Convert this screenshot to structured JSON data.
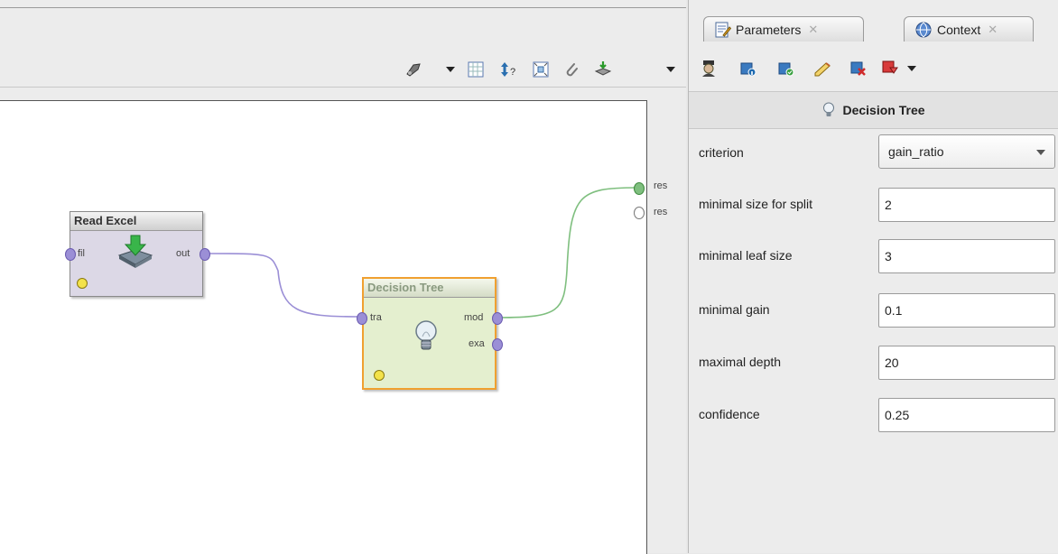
{
  "tabs": [
    {
      "label": "Parameters",
      "icon": "parameters-icon",
      "close": "✕"
    },
    {
      "label": "Context",
      "icon": "globe-icon",
      "close": "✕"
    }
  ],
  "process": {
    "operators": [
      {
        "title": "Read Excel",
        "icon": "download-icon",
        "inputs": [
          "fil"
        ],
        "outputs": [
          "out"
        ]
      },
      {
        "title": "Decision Tree",
        "icon": "lightbulb-icon",
        "inputs": [
          "tra"
        ],
        "outputs": [
          "mod",
          "exa"
        ]
      }
    ],
    "result_ports": [
      "res",
      "res"
    ]
  },
  "panel": {
    "header": "Decision Tree",
    "params": [
      {
        "label": "criterion",
        "value": "gain_ratio",
        "type": "select"
      },
      {
        "label": "minimal size for split",
        "value": "2"
      },
      {
        "label": "minimal leaf size",
        "value": "3"
      },
      {
        "label": "minimal gain",
        "value": "0.1"
      },
      {
        "label": "maximal depth",
        "value": "20"
      },
      {
        "label": "confidence",
        "value": "0.25"
      }
    ]
  },
  "colors": {
    "wire_purple": "#9b8fd6",
    "wire_green": "#7fbf7f",
    "highlight_orange": "#f0a030",
    "operator_bg": "#dcd8e6",
    "selected_bg": "#e4efcf"
  }
}
